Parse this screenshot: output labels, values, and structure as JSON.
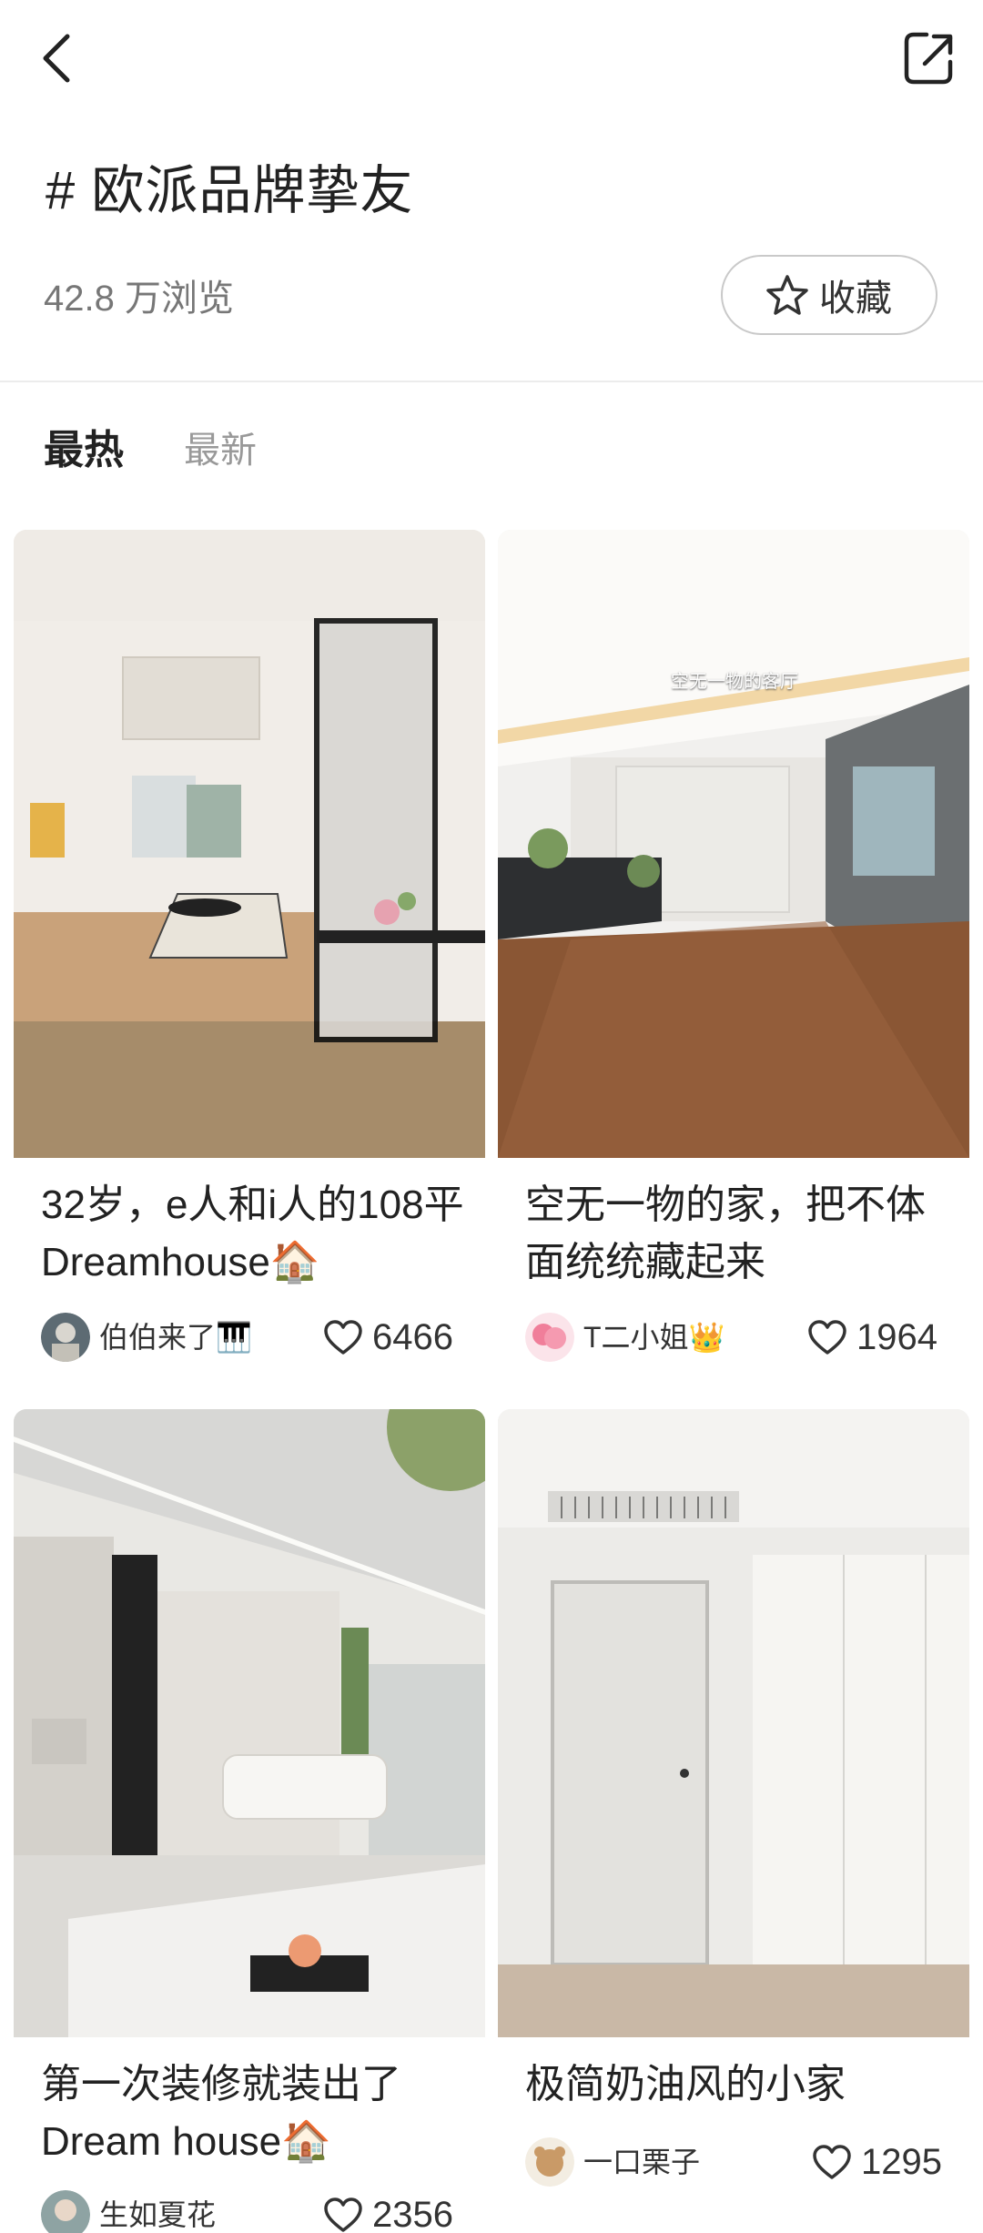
{
  "header": {
    "topic": "# 欧派品牌挚友",
    "views": "42.8 万浏览",
    "favorite_label": "收藏"
  },
  "tabs": [
    "最热",
    "最新"
  ],
  "posts": [
    {
      "title": "32岁，e人和i人的108平Dreamhouse🏠",
      "author": "伯伯来了🎹",
      "likes": "6466",
      "image_caption": ""
    },
    {
      "title": "空无一物的家，把不体面统统藏起来",
      "author": "T二小姐👑",
      "likes": "1964",
      "image_caption": "空无一物的客厅"
    },
    {
      "title": "第一次装修就装出了Dream house🏠",
      "author": "生如夏花",
      "likes": "2356",
      "image_caption": ""
    },
    {
      "title": "极简奶油风的小家",
      "author": "一口栗子",
      "likes": "1295",
      "image_caption": ""
    }
  ],
  "icons": {
    "back": "chevron-left-icon",
    "share": "share-out-icon",
    "favorite": "star-outline-icon",
    "like": "heart-outline-icon"
  },
  "colors": {
    "background": "#ffffff",
    "page_gray": "#f4f4f4",
    "text": "#222222",
    "secondary_text": "#777777"
  }
}
